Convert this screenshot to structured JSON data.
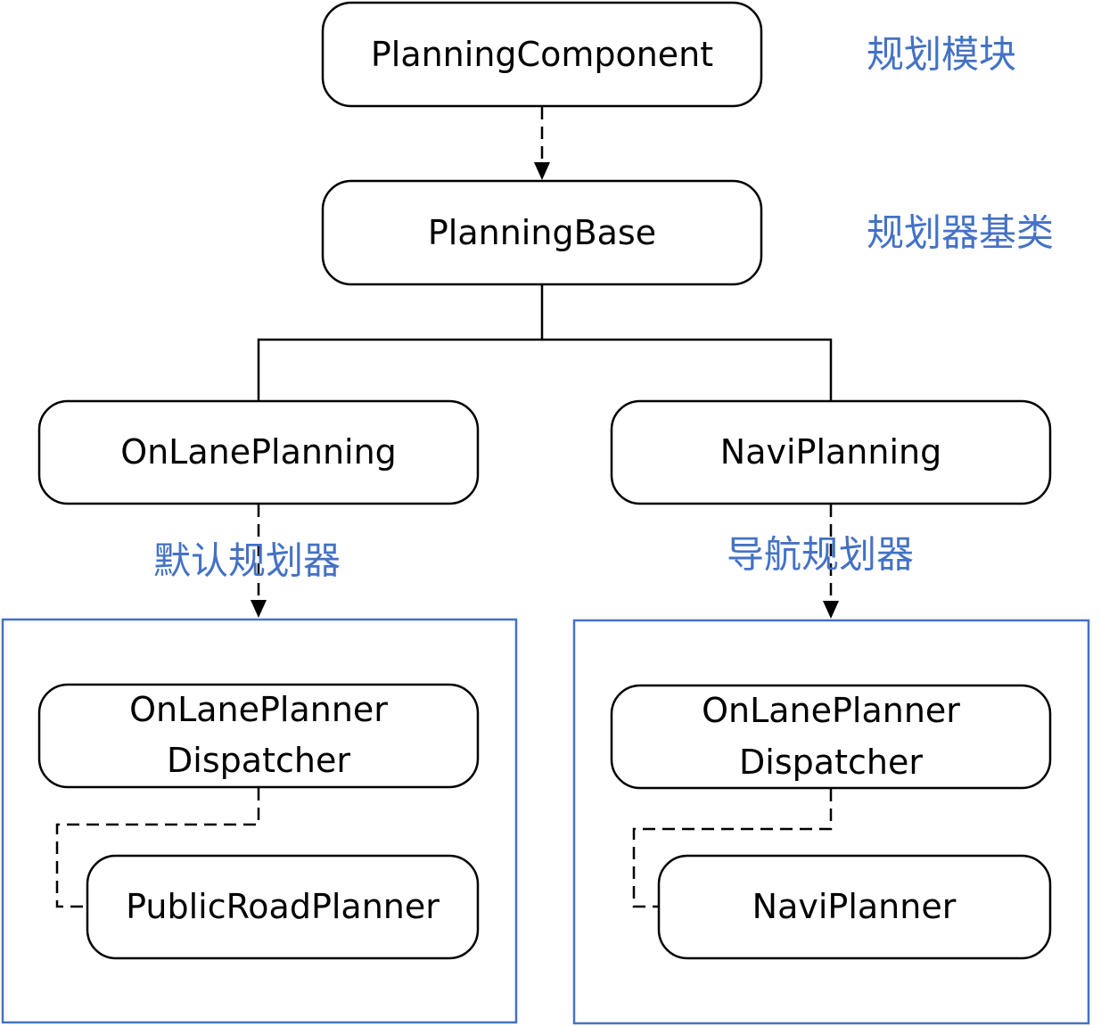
{
  "nodes": {
    "planning_component": "PlanningComponent",
    "planning_base": "PlanningBase",
    "on_lane_planning": "OnLanePlanning",
    "navi_planning": "NaviPlanning",
    "left_dispatcher_line1": "OnLanePlanner",
    "left_dispatcher_line2": "Dispatcher",
    "public_road_planner": "PublicRoadPlanner",
    "right_dispatcher_line1": "OnLanePlanner",
    "right_dispatcher_line2": "Dispatcher",
    "navi_planner": "NaviPlanner"
  },
  "annotations": {
    "planning_module": "规划模块",
    "planner_base_class": "规划器基类",
    "default_planner": "默认规划器",
    "navigation_planner": "导航规划器"
  },
  "colors": {
    "annotation": "#4472c4",
    "group_border": "#4472c4",
    "box_border": "#000000"
  }
}
